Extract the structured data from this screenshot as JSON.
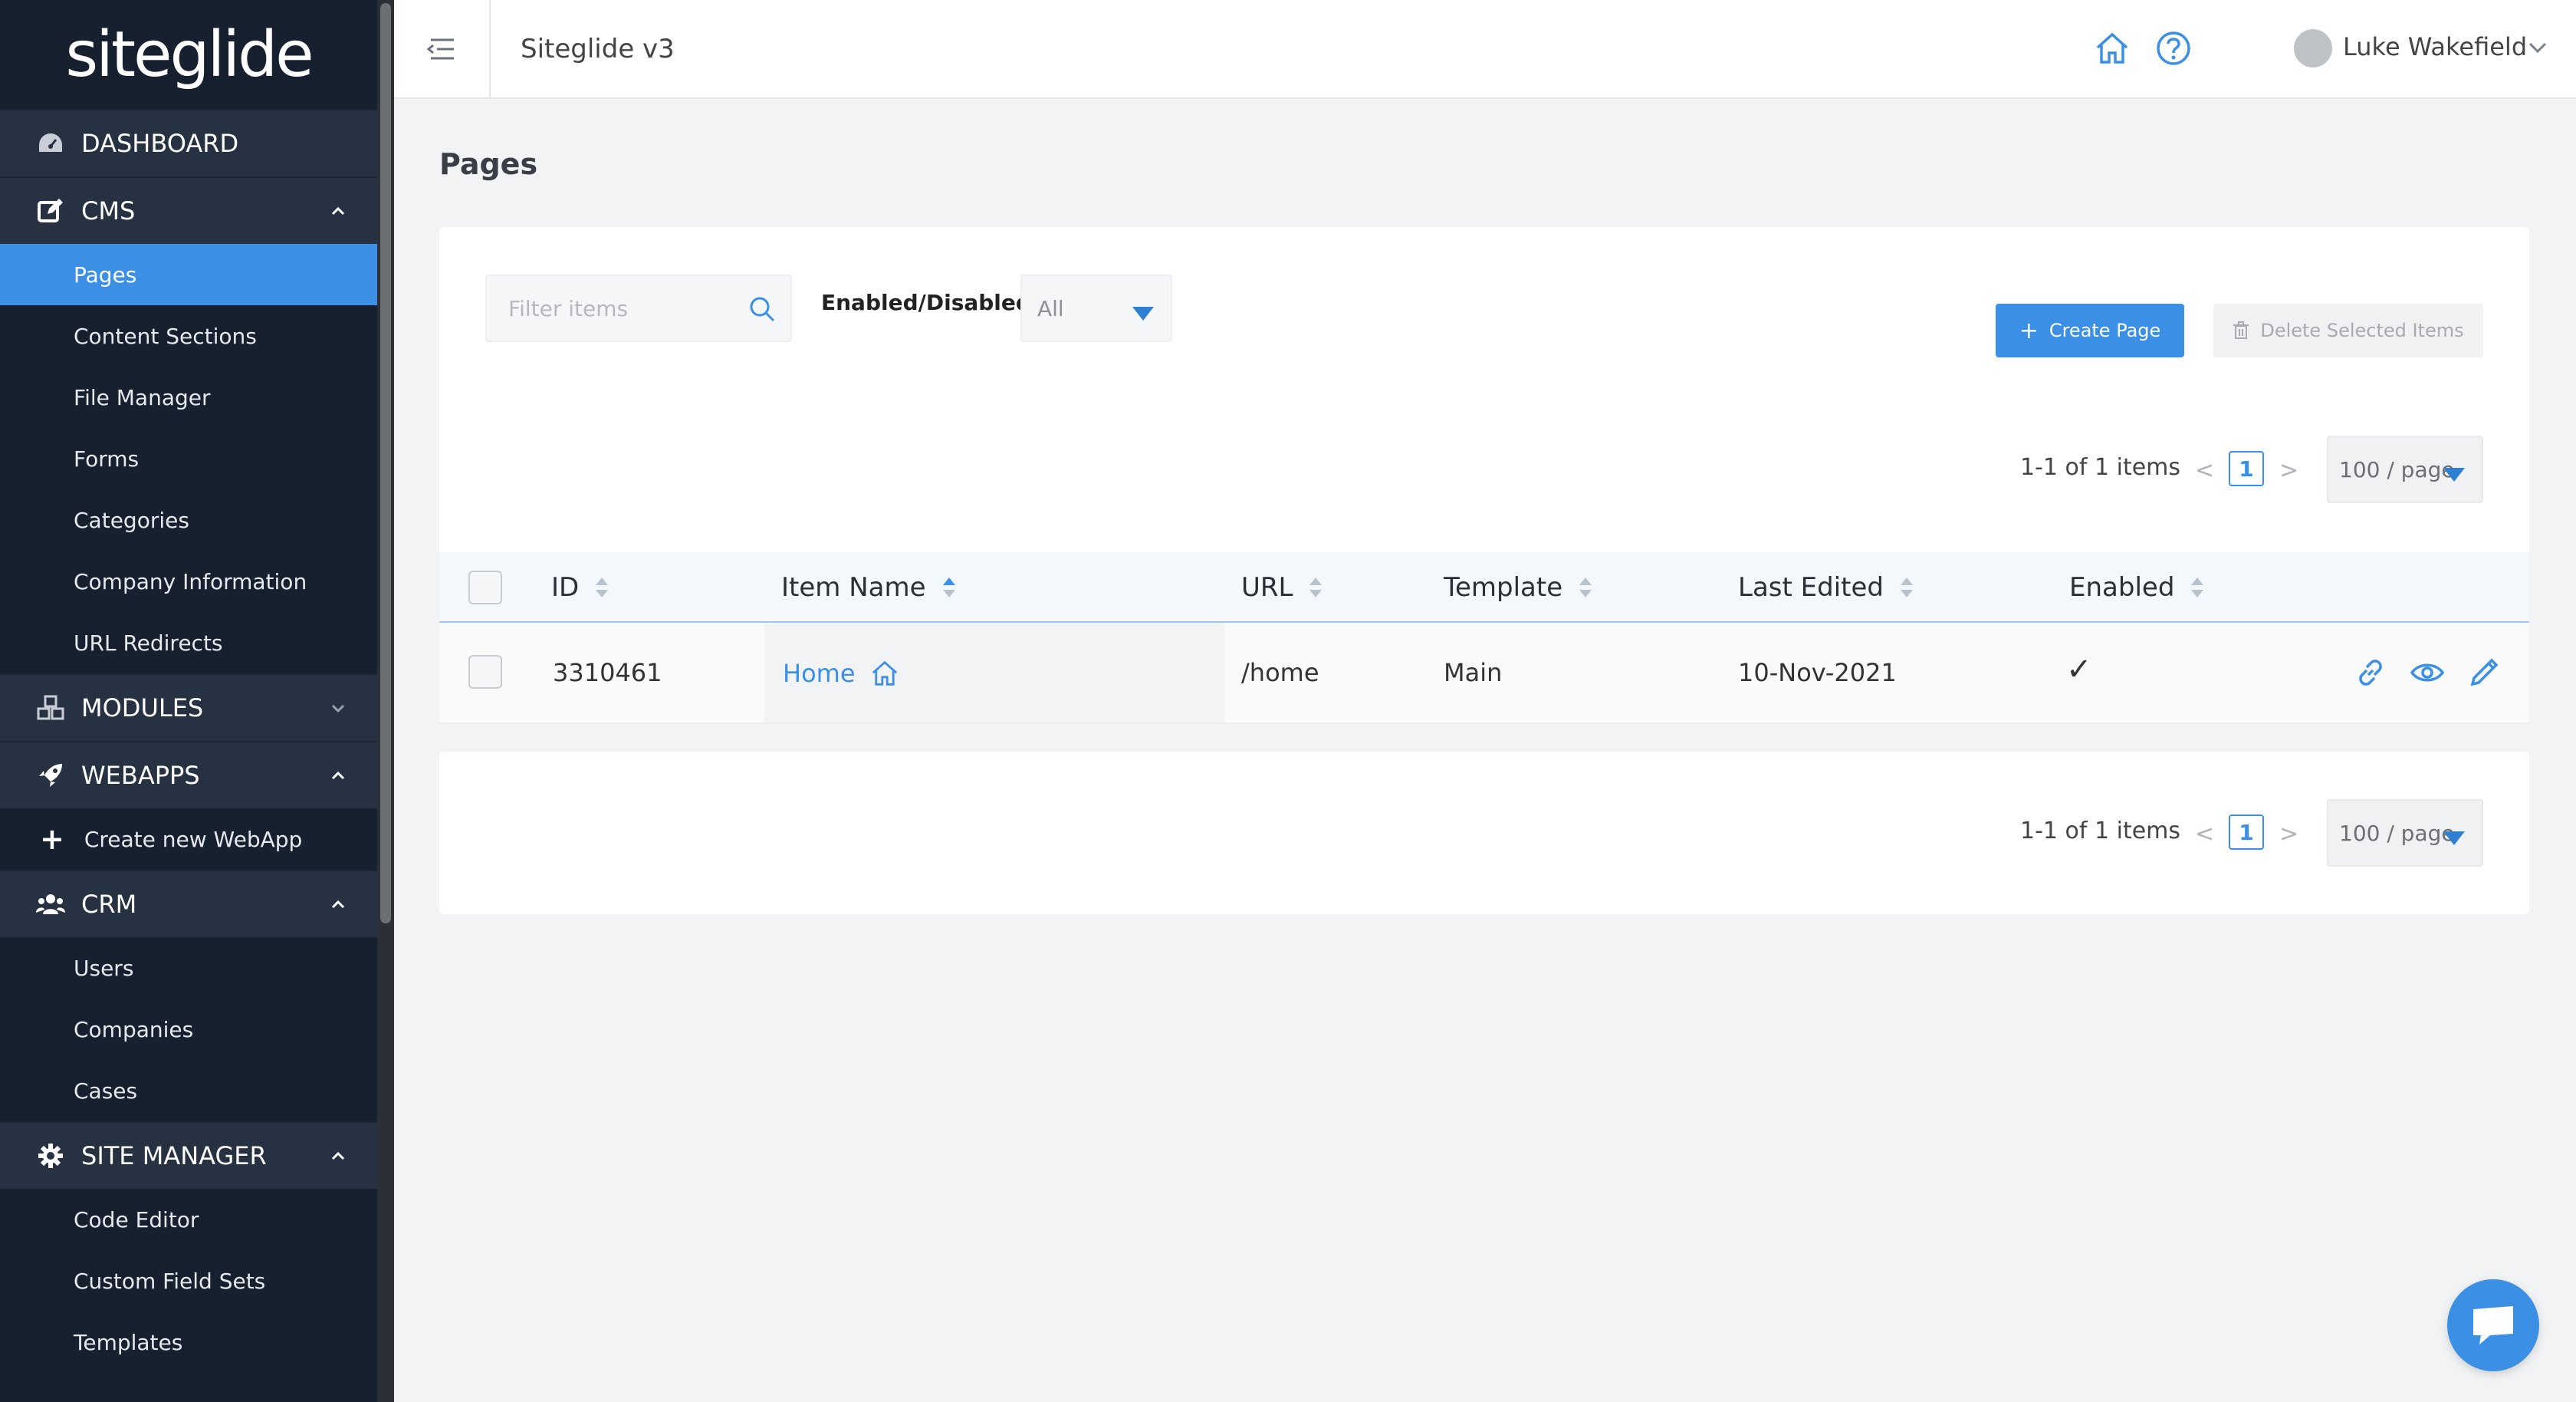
{
  "sidebar": {
    "logo": "siteglide",
    "sections": [
      {
        "label": "DASHBOARD",
        "icon": "dashboard-icon"
      },
      {
        "label": "CMS",
        "icon": "edit-icon"
      },
      {
        "label": "MODULES",
        "icon": "cubes-icon"
      },
      {
        "label": "WEBAPPS",
        "icon": "rocket-icon"
      },
      {
        "label": "CRM",
        "icon": "users-icon"
      },
      {
        "label": "SITE MANAGER",
        "icon": "gear-icon"
      }
    ],
    "cms_items": [
      "Pages",
      "Content Sections",
      "File Manager",
      "Forms",
      "Categories",
      "Company Information",
      "URL Redirects"
    ],
    "webapps_items": [
      "Create new WebApp"
    ],
    "crm_items": [
      "Users",
      "Companies",
      "Cases"
    ],
    "site_manager_items": [
      "Code Editor",
      "Custom Field Sets",
      "Templates"
    ],
    "active_item": "Pages",
    "accent_color": "#3b8fe5"
  },
  "topbar": {
    "title": "Siteglide v3",
    "user_name": "Luke Wakefield",
    "icons": [
      "home-icon",
      "help-icon",
      "history-icon"
    ]
  },
  "main": {
    "page_title": "Pages",
    "filter": {
      "placeholder": "Filter items"
    },
    "enabled_filter": {
      "label": "Enabled/Disabled",
      "separator": ":",
      "value": "All"
    },
    "create_button": "Create Page",
    "delete_button": "Delete Selected Items",
    "pagination": {
      "count": "1-1 of 1 items",
      "current_page": "1",
      "page_size": "100 / page",
      "prev": "<",
      "next": ">"
    },
    "table": {
      "columns": [
        "ID",
        "Item Name",
        "URL",
        "Template",
        "Last Edited",
        "Enabled"
      ],
      "rows": [
        {
          "id": "3310461",
          "name": "Home",
          "url": "/home",
          "template": "Main",
          "last_edited": "10-Nov-2021",
          "enabled": "✓"
        }
      ]
    }
  }
}
